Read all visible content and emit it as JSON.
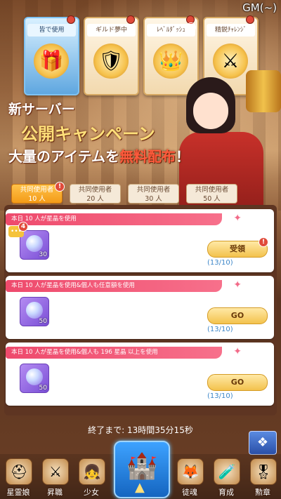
{
  "header": {
    "gm_label": "GM(~)"
  },
  "tiles": [
    {
      "label": "皆で使用",
      "icon": "gift-icon",
      "glyph": "🎁",
      "active": true
    },
    {
      "label": "ギルド夢中",
      "icon": "winged-shield-icon",
      "glyph": "🛡",
      "active": false
    },
    {
      "label": "ﾚﾍﾞﾙﾀﾞｯｼｭ",
      "icon": "crown-up-icon",
      "glyph": "👑",
      "active": false
    },
    {
      "label": "精鋭ﾁｬﾚﾝｼﾞ",
      "icon": "crossed-swords-icon",
      "glyph": "⚔",
      "active": false
    }
  ],
  "banner": {
    "line1": "新サーバー",
    "line2": "公開キャンペーン",
    "line3_a": "大量のアイテムを",
    "line3_b": "無料配布",
    "line3_c": "！"
  },
  "tier_tabs": [
    {
      "line1": "共同使用者",
      "line2": "10 人",
      "active": true
    },
    {
      "line1": "共同使用者",
      "line2": "20 人",
      "active": false
    },
    {
      "line1": "共同使用者",
      "line2": "30 人",
      "active": false
    },
    {
      "line1": "共同使用者",
      "line2": "50 人",
      "active": false
    }
  ],
  "tasks": [
    {
      "title": "本日 10 人が星晶を使用",
      "item_qty": "30",
      "button": "受領",
      "progress": "(13/10)",
      "chat_count": "4",
      "alert": "!"
    },
    {
      "title": "本日 10 人が星晶を使用&個人も任意額を使用",
      "item_qty": "50",
      "button": "GO",
      "progress": "(13/10)"
    },
    {
      "title": "本日 10 人が星晶を使用&個人も 196 星晶 以上を使用",
      "item_qty": "50",
      "button": "GO",
      "progress": "(13/10)"
    }
  ],
  "countdown": "終了まで: 13時間35分15秒",
  "nav": [
    {
      "label": "星霊娘",
      "icon": "knight-helmet-icon",
      "glyph": "⛑"
    },
    {
      "label": "昇職",
      "icon": "crossed-swords-icon",
      "glyph": "⚔"
    },
    {
      "label": "少女",
      "icon": "girl-portrait-icon",
      "glyph": "👧"
    },
    {
      "label": "",
      "icon": "castle-icon",
      "glyph": "🏰"
    },
    {
      "label": "徒魂",
      "icon": "fox-mask-icon",
      "glyph": "🦊"
    },
    {
      "label": "育成",
      "icon": "potion-icon",
      "glyph": "🧪"
    },
    {
      "label": "勲章",
      "icon": "medal-icon",
      "glyph": "🎖"
    }
  ]
}
